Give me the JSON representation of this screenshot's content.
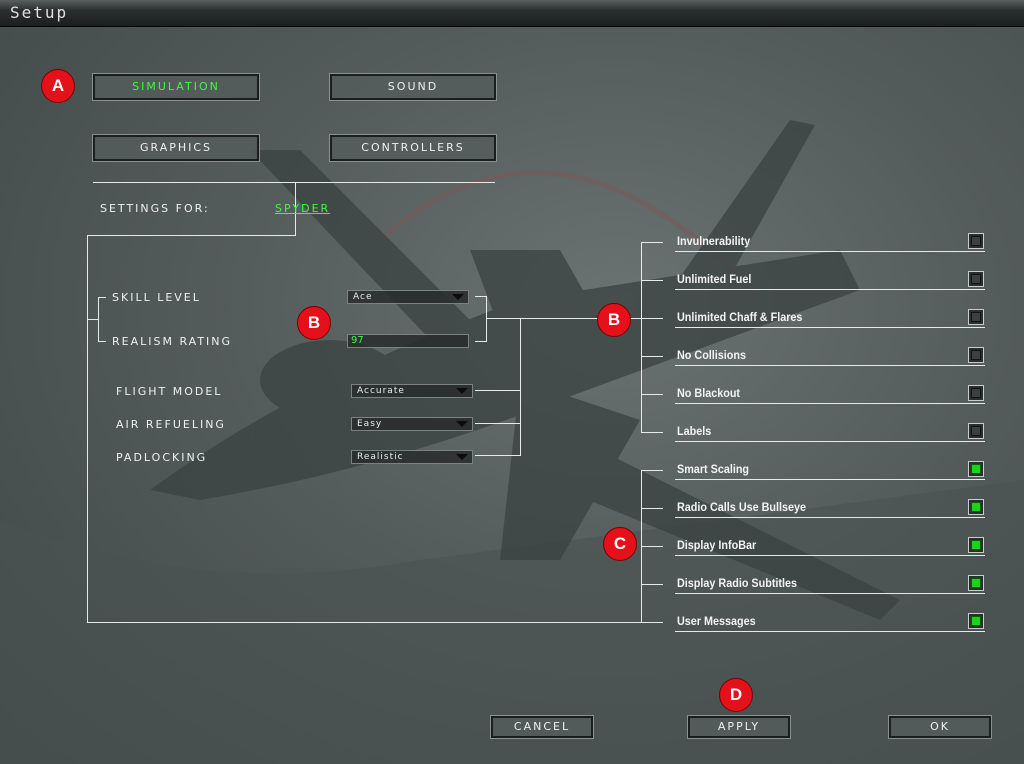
{
  "window": {
    "title": "Setup"
  },
  "tabs": [
    {
      "label": "Simulation",
      "active": true
    },
    {
      "label": "Sound",
      "active": false
    },
    {
      "label": "Graphics",
      "active": false
    },
    {
      "label": "Controllers",
      "active": false
    }
  ],
  "settings_for": {
    "label": "Settings For:",
    "value": "Spyder"
  },
  "settings": {
    "skill_level": {
      "label": "Skill Level",
      "value": "Ace"
    },
    "realism_rating": {
      "label": "Realism Rating",
      "value": "97"
    },
    "flight_model": {
      "label": "Flight Model",
      "value": "Accurate"
    },
    "air_refueling": {
      "label": "Air Refueling",
      "value": "Easy"
    },
    "padlocking": {
      "label": "Padlocking",
      "value": "Realistic"
    }
  },
  "options": [
    {
      "label": "Invulnerability",
      "checked": false
    },
    {
      "label": "Unlimited Fuel",
      "checked": false
    },
    {
      "label": "Unlimited Chaff & Flares",
      "checked": false
    },
    {
      "label": "No Collisions",
      "checked": false
    },
    {
      "label": "No Blackout",
      "checked": false
    },
    {
      "label": "Labels",
      "checked": false
    },
    {
      "label": "Smart Scaling",
      "checked": true
    },
    {
      "label": "Radio Calls Use Bullseye",
      "checked": true
    },
    {
      "label": "Display InfoBar",
      "checked": true
    },
    {
      "label": "Display Radio Subtitles",
      "checked": true
    },
    {
      "label": "User Messages",
      "checked": true
    }
  ],
  "buttons": {
    "cancel": "Cancel",
    "apply": "Apply",
    "ok": "Ok"
  },
  "callouts": {
    "a": "A",
    "b1": "B",
    "b2": "B",
    "c": "C",
    "d": "D"
  },
  "colors": {
    "accent_green": "#3dfa3d",
    "callout_red": "#e4111a",
    "panel_bg": "#545b5b"
  }
}
